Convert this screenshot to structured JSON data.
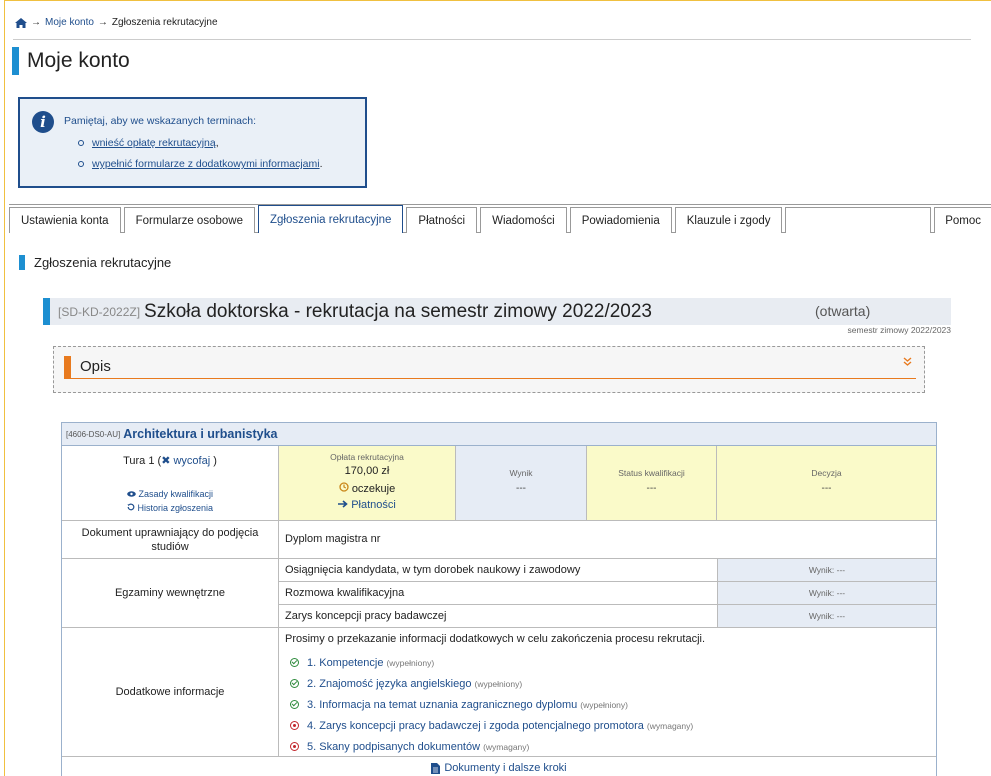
{
  "breadcrumb": {
    "home_icon": "home-icon",
    "sep1": "→",
    "item1": "Moje konto",
    "sep2": "→",
    "item2": "Zgłoszenia rekrutacyjne"
  },
  "page_title": "Moje konto",
  "info": {
    "icon": "info-icon",
    "text": "Pamiętaj, aby we wskazanych terminach:",
    "items": [
      {
        "label": "wnieść opłatę rekrutacyjną",
        "suffix": ","
      },
      {
        "label": "wypełnić formularze z dodatkowymi informacjami",
        "suffix": "."
      }
    ]
  },
  "tabs": [
    {
      "label": "Ustawienia konta",
      "active": false
    },
    {
      "label": "Formularze osobowe",
      "active": false
    },
    {
      "label": "Zgłoszenia rekrutacyjne",
      "active": true
    },
    {
      "label": "Płatności",
      "active": false
    },
    {
      "label": "Wiadomości",
      "active": false
    },
    {
      "label": "Powiadomienia",
      "active": false
    },
    {
      "label": "Klauzule i zgody",
      "active": false
    },
    {
      "label": "Pomoc",
      "active": false
    }
  ],
  "section_title": "Zgłoszenia rekrutacyjne",
  "recruitment": {
    "code": "[SD-KD-2022Z]",
    "name": "Szkoła doktorska - rekrutacja na semestr zimowy 2022/2023",
    "status": "(otwarta)",
    "semester": "semestr zimowy 2022/2023"
  },
  "opis": {
    "title": "Opis",
    "chevron": "»"
  },
  "program": {
    "code": "[4606-DS0-AU]",
    "name": "Architektura i urbanistyka",
    "tura": {
      "label": "Tura 1",
      "open_paren": "(",
      "cancel_icon": "✖",
      "cancel_label": "wycofaj",
      "close_paren": ")",
      "rules_label": "Zasady kwalifikacji",
      "history_label": "Historia zgłoszenia"
    },
    "oplata": {
      "label": "Opłata rekrutacyjna",
      "amount": "170,00 zł",
      "status": "oczekuje",
      "pay_label": "Płatności"
    },
    "wynik": {
      "label": "Wynik",
      "value": "---"
    },
    "status_kwal": {
      "label": "Status kwalifikacji",
      "value": "---"
    },
    "decyzja": {
      "label": "Decyzja",
      "value": "---"
    },
    "document": {
      "label": "Dokument uprawniający do podjęcia studiów",
      "value": "Dyplom magistra nr"
    },
    "exams": {
      "label": "Egzaminy wewnętrzne",
      "items": [
        {
          "name": "Osiągnięcia kandydata, w tym dorobek naukowy i zawodowy",
          "result": "Wynik: ---"
        },
        {
          "name": "Rozmowa kwalifikacyjna",
          "result": "Wynik: ---"
        },
        {
          "name": "Zarys koncepcji pracy badawczej",
          "result": "Wynik: ---"
        }
      ]
    },
    "additional": {
      "label": "Dodatkowe informacje",
      "intro": "Prosimy o przekazanie informacji dodatkowych w celu zakończenia procesu rekrutacji.",
      "items": [
        {
          "title": "1. Kompetencje",
          "state": "(wypełniony)",
          "ok": true
        },
        {
          "title": "2. Znajomość języka angielskiego",
          "state": "(wypełniony)",
          "ok": true
        },
        {
          "title": "3. Informacja na temat uznania zagranicznego dyplomu",
          "state": "(wypełniony)",
          "ok": true
        },
        {
          "title": "4. Zarys koncepcji pracy badawczej i zgoda potencjalnego promotora",
          "state": "(wymagany)",
          "ok": false
        },
        {
          "title": "5. Skany podpisanych dokumentów",
          "state": "(wymagany)",
          "ok": false
        }
      ]
    },
    "footer_link": "Dokumenty i dalsze kroki"
  },
  "colors": {
    "accent": "#1d8fd1",
    "link": "#1f4e8c",
    "orange": "#e87a1e",
    "ok": "#2e8b3c",
    "required": "#c2272d"
  }
}
